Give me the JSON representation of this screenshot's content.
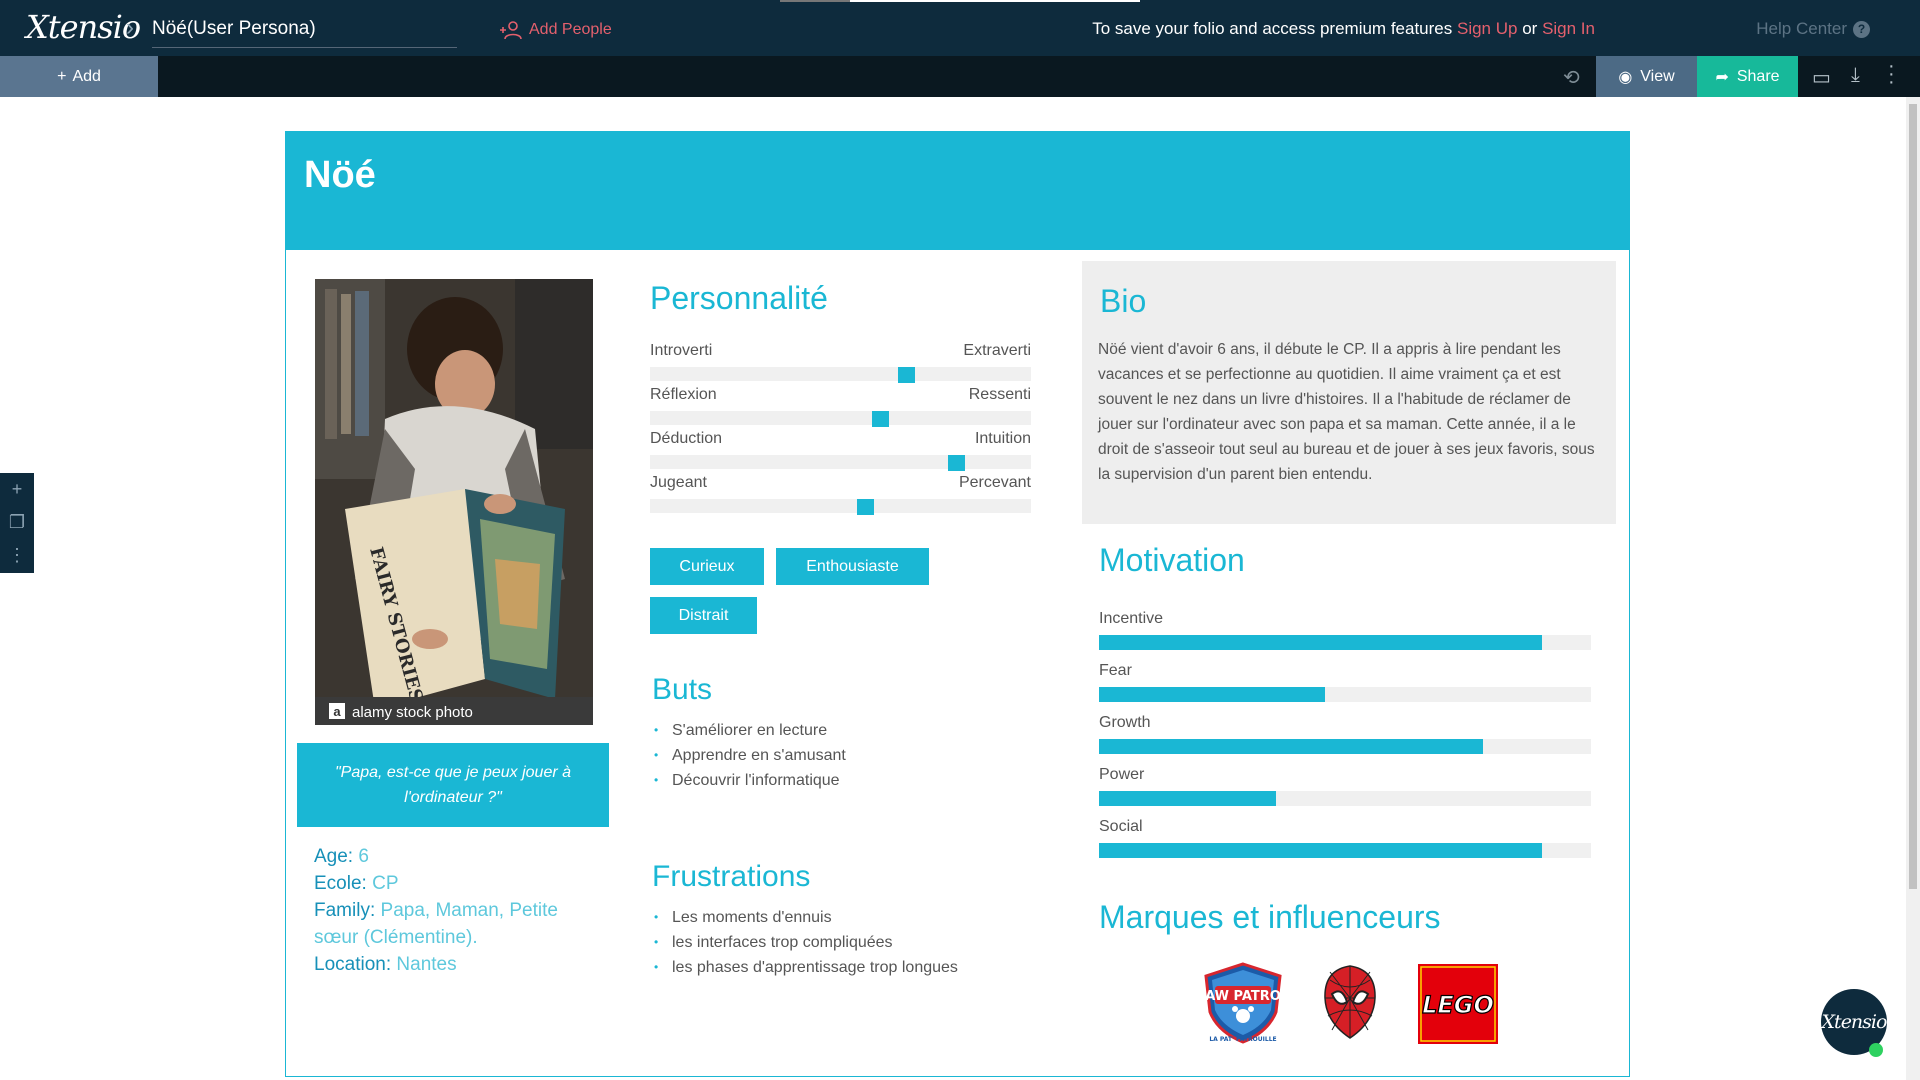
{
  "app": {
    "logo": "Xtensio",
    "doc_title": "Nöé(User Persona)",
    "add_people": "Add People",
    "save_msg_prefix": "To save your folio and access premium features",
    "sign_up": "Sign Up",
    "or": "or",
    "sign_in": "Sign In",
    "help_center": "Help Center",
    "add_button": "Add",
    "view_button": "View",
    "share_button": "Share",
    "fab_logo": "Xtensio"
  },
  "persona": {
    "name": "Nöé",
    "photo_watermark": "alamy stock photo",
    "photo_book_text": "FAIRY STORIES AND NURSERY RHYMES",
    "quote": "\"Papa, est-ce que je peux jouer à l'ordinateur ?\"",
    "facts": [
      {
        "key": "Age:",
        "value": "6"
      },
      {
        "key": "Ecole:",
        "value": "CP"
      },
      {
        "key": "Family:",
        "value": "Papa, Maman, Petite sœur (Clémentine)."
      },
      {
        "key": "Location:",
        "value": "Nantes"
      }
    ],
    "personality_title": "Personnalité",
    "personality": [
      {
        "left": "Introverti",
        "right": "Extraverti",
        "level": 0.68
      },
      {
        "left": "Réflexion",
        "right": "Ressenti",
        "level": 0.61
      },
      {
        "left": "Déduction",
        "right": "Intuition",
        "level": 0.82
      },
      {
        "left": "Jugeant",
        "right": "Percevant",
        "level": 0.57
      }
    ],
    "traits": [
      "Curieux",
      "Enthousiaste",
      "Distrait"
    ],
    "goals_title": "Buts",
    "goals": [
      "S'améliorer en lecture",
      "Apprendre en s'amusant",
      "Découvrir l'informatique"
    ],
    "frustrations_title": "Frustrations",
    "frustrations": [
      "Les moments d'ennuis",
      "les interfaces trop compliquées",
      "les phases d'apprentissage trop longues"
    ],
    "bio_title": "Bio",
    "bio": "Nöé vient d'avoir 6 ans, il débute le CP. Il a appris à lire pendant les vacances et se perfectionne au quotidien. Il aime vraiment ça et est souvent le nez dans un livre d'histoires. Il a l'habitude de réclamer de jouer sur l'ordinateur avec son papa et sa maman. Cette année, il a le droit de s'asseoir tout seul au bureau et de jouer à ses jeux favoris, sous la supervision d'un parent bien entendu.",
    "motivation_title": "Motivation",
    "motivation": [
      {
        "label": "Incentive",
        "level": 0.9
      },
      {
        "label": "Fear",
        "level": 0.46
      },
      {
        "label": "Growth",
        "level": 0.78
      },
      {
        "label": "Power",
        "level": 0.36
      },
      {
        "label": "Social",
        "level": 0.9
      }
    ],
    "brands_title": "Marques et influenceurs",
    "brands": [
      {
        "name": "PAW PATROL",
        "caption": "LA PAT' PATROUILLE",
        "icon": "paw-patrol-logo"
      },
      {
        "name": "Spider-Man",
        "icon": "spiderman-logo"
      },
      {
        "name": "LEGO",
        "icon": "lego-logo"
      }
    ]
  },
  "colors": {
    "accent": "#1ab7d4",
    "header_bg": "#0e2b3d",
    "link": "#e4606d",
    "share": "#17b99a"
  }
}
